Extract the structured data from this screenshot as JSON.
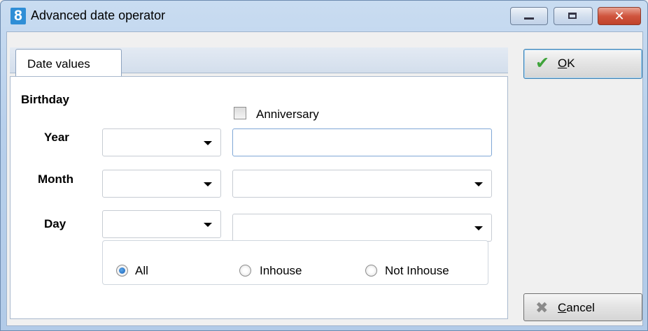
{
  "window": {
    "app_icon_glyph": "8",
    "title": "Advanced date operator",
    "close_glyph": "✕"
  },
  "tabs": [
    {
      "label": "Date values",
      "active": true
    }
  ],
  "section": {
    "heading": "Birthday"
  },
  "anniversary": {
    "label": "Anniversary",
    "checked": false
  },
  "rows": {
    "year": {
      "label": "Year",
      "operator": "",
      "value": ""
    },
    "month": {
      "label": "Month",
      "operator": "",
      "value": ""
    },
    "day": {
      "label": "Day",
      "operator": "",
      "value": ""
    }
  },
  "filter": {
    "options": [
      {
        "label": "All",
        "checked": true
      },
      {
        "label": "Inhouse",
        "checked": false
      },
      {
        "label": "Not Inhouse",
        "checked": false
      }
    ]
  },
  "buttons": {
    "ok": {
      "label": "OK",
      "mnemonic": "O",
      "rest": "K",
      "icon": "checkmark-icon"
    },
    "cancel": {
      "label": "Cancel",
      "mnemonic": "C",
      "rest": "ancel",
      "icon": "cancel-icon"
    }
  },
  "colors": {
    "title_gradient_top": "#c9dcf1",
    "close_button": "#c0422a",
    "ok_border": "#3c7fb1",
    "radio_selected": "#1a5fb4",
    "ok_icon": "#3fa33a"
  }
}
